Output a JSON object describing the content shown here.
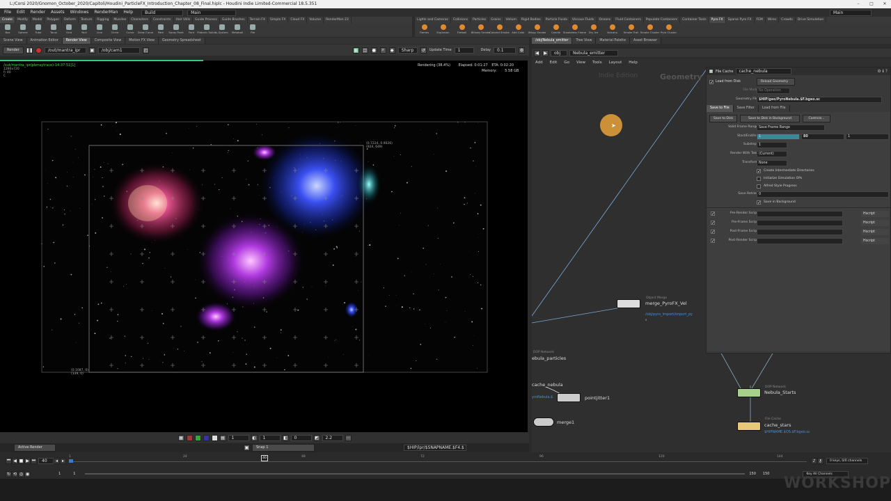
{
  "window": {
    "title": "L:/Corsi 2020/Gnomon_October_2020/Capitoli/Houdini_ParticleFX_Introduction_Chapter_08_Final.hiplc - Houdini Indie Limited-Commercial 18.5.351"
  },
  "menu": {
    "items": [
      "File",
      "Edit",
      "Render",
      "Assets",
      "Windows",
      "RenderMan",
      "Help"
    ],
    "build_label": "Build",
    "desktop_label": "Main",
    "right_desktop_label": "Main"
  },
  "shelf_tabs_left": [
    "Create",
    "Modify",
    "Model",
    "Polygon",
    "Deform",
    "Texture",
    "Rigging",
    "Muscles",
    "Characters",
    "Constraints",
    "Hair Utils",
    "Guide Process",
    "Guide Brushes",
    "Terrain FX",
    "Simple FX",
    "Cloud FX",
    "Volume",
    "RenderMan 23"
  ],
  "shelf_tabs_right": [
    "Lights and Cameras",
    "Collisions",
    "Particles",
    "Grains",
    "Vellum",
    "Rigid Bodies",
    "Particle Fluids",
    "Viscous Fluids",
    "Oceans",
    "Fluid Containers",
    "Populate Containers",
    "Container Tools",
    "Pyro FX",
    "Sparse Pyro FX",
    "FEM",
    "Wires",
    "Crowds",
    "Drive Simulation"
  ],
  "shelf_tabs_right_active": "Pyro FX",
  "shelf_tools_left": [
    "Box",
    "Sphere",
    "Tube",
    "Torus",
    "Grid",
    "Null",
    "Line",
    "Circle",
    "Curve",
    "Draw Curve",
    "Path",
    "Spray Paint",
    "Font",
    "Platonic Solids",
    "L-System",
    "Metaball",
    "File"
  ],
  "shelf_tools_right": [
    "Flames",
    "Explosion",
    "Fireball",
    "Billowy Smoke",
    "Colored Smoke",
    "Add Color",
    "Wispy Smoke",
    "Candle",
    "Smokeless Flame",
    "Dry Ice",
    "Volcano",
    "Smoke Trail",
    "Smoke Cluster",
    "Pyro Cluster"
  ],
  "pane_tabs_left": [
    "Scene View",
    "Animation Editor",
    "Render View",
    "Composite View",
    "Motion FX View",
    "Geometry Spreadsheet"
  ],
  "pane_tabs_left_active": "Render View",
  "pane_tabs_right": [
    "/obj/Nebula_emitter",
    "Tree View",
    "Material Palette",
    "Asset Browser"
  ],
  "render_toolbar": {
    "render_label": "Render",
    "rop_path": "/out/mantra_ipr",
    "camera_path": "/obj/cam1",
    "sharp_label": "Sharp",
    "update_time_label": "Update Time",
    "update_time_value": "1",
    "delay_label": "Delay",
    "delay_value": "0.1"
  },
  "render_view": {
    "title_line": "/out/mantra_ipr(pbrraytrace)-14:37:51[1]",
    "resolution": "1280x720",
    "frame": "fr 40",
    "channel": "C",
    "rendering": "Rendering (38.4%)",
    "elapsed": "Elapsed: 0:01:27",
    "eta": "ETA: 0:02:20",
    "memory_label": "Memory:",
    "memory_value": "5.58 GB",
    "crop_coord_top": "(0.7224, 0.9026)",
    "crop_pixel_top": "(924, 649)",
    "crop_coord_bottom": "(0.1087, 0)",
    "crop_pixel_bottom": "(139, 0)",
    "progress": 0.384
  },
  "viewport_bottom": {
    "frame_a": "1",
    "frame_b": "1",
    "value_c": "0",
    "gamma": "2.2",
    "snap_label": "Snap",
    "snap_value": "1",
    "status_path": "$HIP/ipr/$SNAPNAME.$F4.$"
  },
  "status": {
    "active_render": "Active Render"
  },
  "network": {
    "path_obj": "obj",
    "path_node": "Nebula_emitter",
    "menu": [
      "Add",
      "Edit",
      "Go",
      "View",
      "Tools",
      "Layout",
      "Help"
    ],
    "watermark": "Indie Edition",
    "context_label": "Geometry"
  },
  "nodes": {
    "merge_pyro": {
      "type": "Object Merge",
      "name": "merge_PyroFX_Vel",
      "path": "/obj/pyro_import/import_py",
      "extra": "s"
    },
    "dop_particles": {
      "type": "DOP Network",
      "name": "ebula_particles"
    },
    "cache_nebula": {
      "name": "cache_nebula",
      "path": "yroNebula.$"
    },
    "pointjitter": {
      "name": "pointjitter1"
    },
    "merge1": {
      "name": "merge1"
    },
    "dop_starts": {
      "type": "DOP Network",
      "name": "Nebula_Starts"
    },
    "cache_stars": {
      "type": "File Cache",
      "name": "cache_stars",
      "path": "$HIPNAME.$OS.$F.bgeo.sc"
    }
  },
  "params": {
    "node_type": "File Cache",
    "node_name": "cache_nebula",
    "load_from_disk": "Load from Disk",
    "reload_geometry": "Reload Geometry",
    "file_mode_label": "File Mode",
    "file_mode_value": "No Operation",
    "geometry_file_label": "Geometry File",
    "geometry_file_value": "$HIP/geo/PyroNebula.$F.bgeo.sc",
    "tabs": [
      "Save to File",
      "Save Filter",
      "Load from File"
    ],
    "save_to_disk": "Save to Disk",
    "save_to_disk_bg": "Save to Disk in Background",
    "controls": "Controls...",
    "valid_frame_range_label": "Valid Frame Range",
    "valid_frame_range_value": "Save Frame Range",
    "start_end_label": "Start/End/Inc",
    "start_value": "1",
    "end_value": "80",
    "inc_value": "1",
    "substeps_label": "Substeps",
    "substeps_value": "1",
    "render_with_take_label": "Render With Take",
    "render_with_take_value": "(Current)",
    "transform_label": "Transform",
    "transform_value": "None",
    "checkboxes": [
      "Create Intermediate Directories",
      "Initialize Simulation OPs",
      "Alfred Style Progress"
    ],
    "checkbox_states": [
      true,
      false,
      false
    ],
    "save_retries_label": "Save Retries",
    "save_retries_value": "0",
    "save_in_background": "Save in Background",
    "scripts": [
      "Pre-Render Script",
      "Pre-Frame Script",
      "Post-Frame Script",
      "Post-Render Script"
    ],
    "script_lang": "Hscript"
  },
  "timeline": {
    "current_frame": "40",
    "ticks": [
      "1",
      "24",
      "48",
      "72",
      "96",
      "120",
      "144"
    ],
    "range_start": "1",
    "range_start2": "1",
    "range_end": "150",
    "range_end2": "150",
    "keys_label": "0 keys, 0/0 channels",
    "key_all_channels": "Key All Channels",
    "current_fraction": 0.26
  },
  "colors": {
    "accent_orange": "#e8a23a",
    "ipr_green": "#4ad04a",
    "node_path_blue": "#4a8fd9",
    "file_cache_node": "#e8c97a",
    "dop_node": "#a8d08d"
  },
  "branding": "WORKSHOP"
}
